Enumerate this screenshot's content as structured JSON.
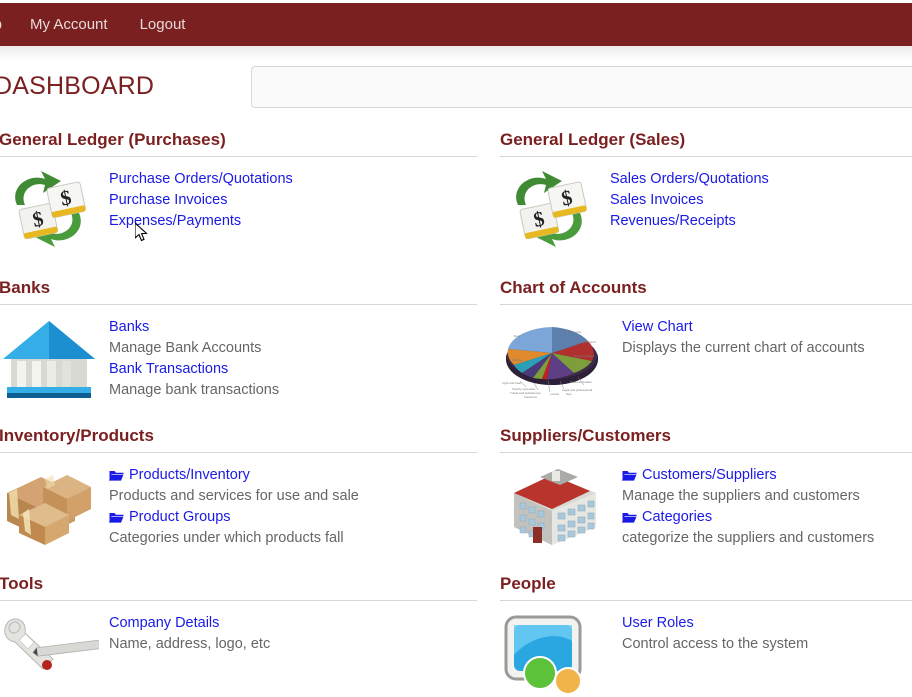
{
  "topnav": {
    "items": [
      {
        "label": "elp",
        "name": "help"
      },
      {
        "label": "My Account",
        "name": "my-account"
      },
      {
        "label": "Logout",
        "name": "logout"
      }
    ],
    "background_color": "#7b2020"
  },
  "header": {
    "page_title": "DASHBOARD",
    "title_color": "#7b2020",
    "search": {
      "value": "",
      "placeholder": ""
    }
  },
  "theme": {
    "link_color": "#1a1ae6",
    "heading_color": "#7b2020",
    "description_color": "#666666",
    "rule_color": "#d6d6d6"
  },
  "sections": [
    {
      "id": "general-ledger-purchases",
      "title": "General Ledger (Purchases)",
      "icon": "money-exchange-icon",
      "items": [
        {
          "link": "Purchase Orders/Quotations",
          "desc": "",
          "folder": false
        },
        {
          "link": "Purchase Invoices",
          "desc": "",
          "folder": false
        },
        {
          "link": "Expenses/Payments",
          "desc": "",
          "folder": false
        }
      ]
    },
    {
      "id": "general-ledger-sales",
      "title": "General Ledger (Sales)",
      "icon": "money-exchange-icon",
      "items": [
        {
          "link": "Sales Orders/Quotations",
          "desc": "",
          "folder": false
        },
        {
          "link": "Sales Invoices",
          "desc": "",
          "folder": false
        },
        {
          "link": "Revenues/Receipts",
          "desc": "",
          "folder": false
        }
      ]
    },
    {
      "id": "banks",
      "title": "Banks",
      "icon": "bank-building-icon",
      "items": [
        {
          "link": "Banks",
          "desc": "Manage Bank Accounts",
          "folder": false
        },
        {
          "link": "Bank Transactions",
          "desc": "Manage bank transactions",
          "folder": false
        }
      ]
    },
    {
      "id": "chart-of-accounts",
      "title": "Chart of Accounts",
      "icon": "pie-chart-icon",
      "items": [
        {
          "link": "View Chart",
          "desc": "Displays the current chart of accounts",
          "folder": false
        }
      ]
    },
    {
      "id": "inventory-products",
      "title": "Inventory/Products",
      "icon": "boxes-icon",
      "items": [
        {
          "link": "Products/Inventory",
          "desc": "Products and services for use and sale",
          "folder": true
        },
        {
          "link": "Product Groups",
          "desc": "Categories under which products fall",
          "folder": true
        }
      ]
    },
    {
      "id": "suppliers-customers",
      "title": "Suppliers/Customers",
      "icon": "office-building-icon",
      "items": [
        {
          "link": "Customers/Suppliers",
          "desc": "Manage the suppliers and customers",
          "folder": true
        },
        {
          "link": "Categories",
          "desc": "categorize the suppliers and customers",
          "folder": true
        }
      ]
    },
    {
      "id": "tools",
      "title": "Tools",
      "icon": "wrench-pencil-icon",
      "items": [
        {
          "link": "Company Details",
          "desc": "Name, address, logo, etc",
          "folder": false
        }
      ]
    },
    {
      "id": "people",
      "title": "People",
      "icon": "user-roles-icon",
      "items": [
        {
          "link": "User Roles",
          "desc": "Control access to the system",
          "folder": false
        }
      ]
    }
  ]
}
